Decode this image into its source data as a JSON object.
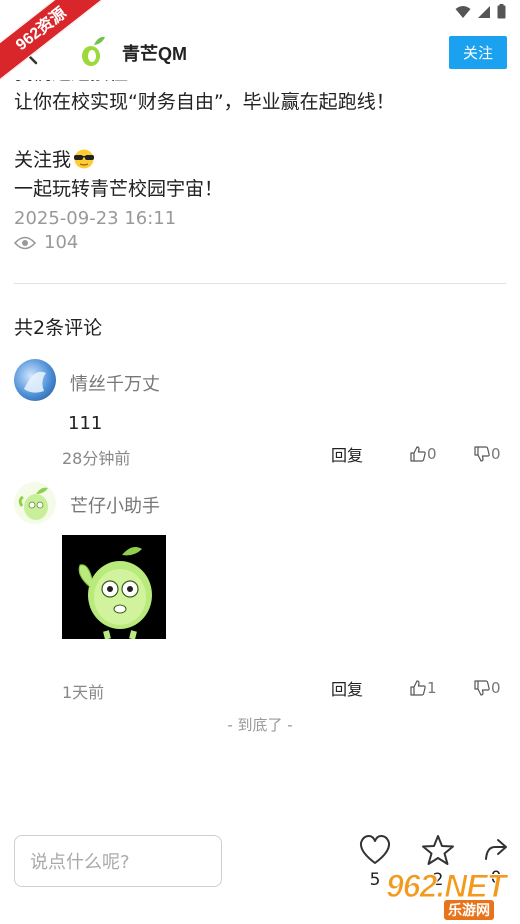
{
  "watermark": {
    "ribbon": "962资源",
    "site_big": "962.NET",
    "site_small": "乐游网"
  },
  "header": {
    "title": "青芒QM",
    "follow_label": "关注"
  },
  "article": {
    "cut_line": "我们通通接住！",
    "line1": "让你在校实现“财务自由”，毕业赢在起跑线！",
    "line2": "关注我",
    "line3": "一起玩转青芒校园宇宙！",
    "date": "2025-09-23 16:11",
    "views": "104"
  },
  "comments": {
    "count_label": "共2条评论",
    "items": [
      {
        "username": "情丝千万丈",
        "text": "111",
        "time": "28分钟前",
        "reply": "回复",
        "likes": "0",
        "dislikes": "0"
      },
      {
        "username": "芒仔小助手",
        "text": "",
        "time": "1天前",
        "reply": "回复",
        "likes": "1",
        "dislikes": "0"
      }
    ],
    "end_text": "- 到底了 -"
  },
  "bottom_bar": {
    "input_placeholder": "说点什么呢?",
    "like_count": "5",
    "favorite_count": "2",
    "share_count": "0"
  },
  "colors": {
    "accent": "#1aa1f0",
    "muted": "#999999"
  },
  "icons": [
    "wifi-icon",
    "signal-icon",
    "battery-icon",
    "back-arrow-icon",
    "app-logo-icon",
    "sunglasses-emoji-icon",
    "eye-icon",
    "thumbs-up-icon",
    "thumbs-down-icon",
    "heart-icon",
    "star-icon",
    "share-icon"
  ]
}
